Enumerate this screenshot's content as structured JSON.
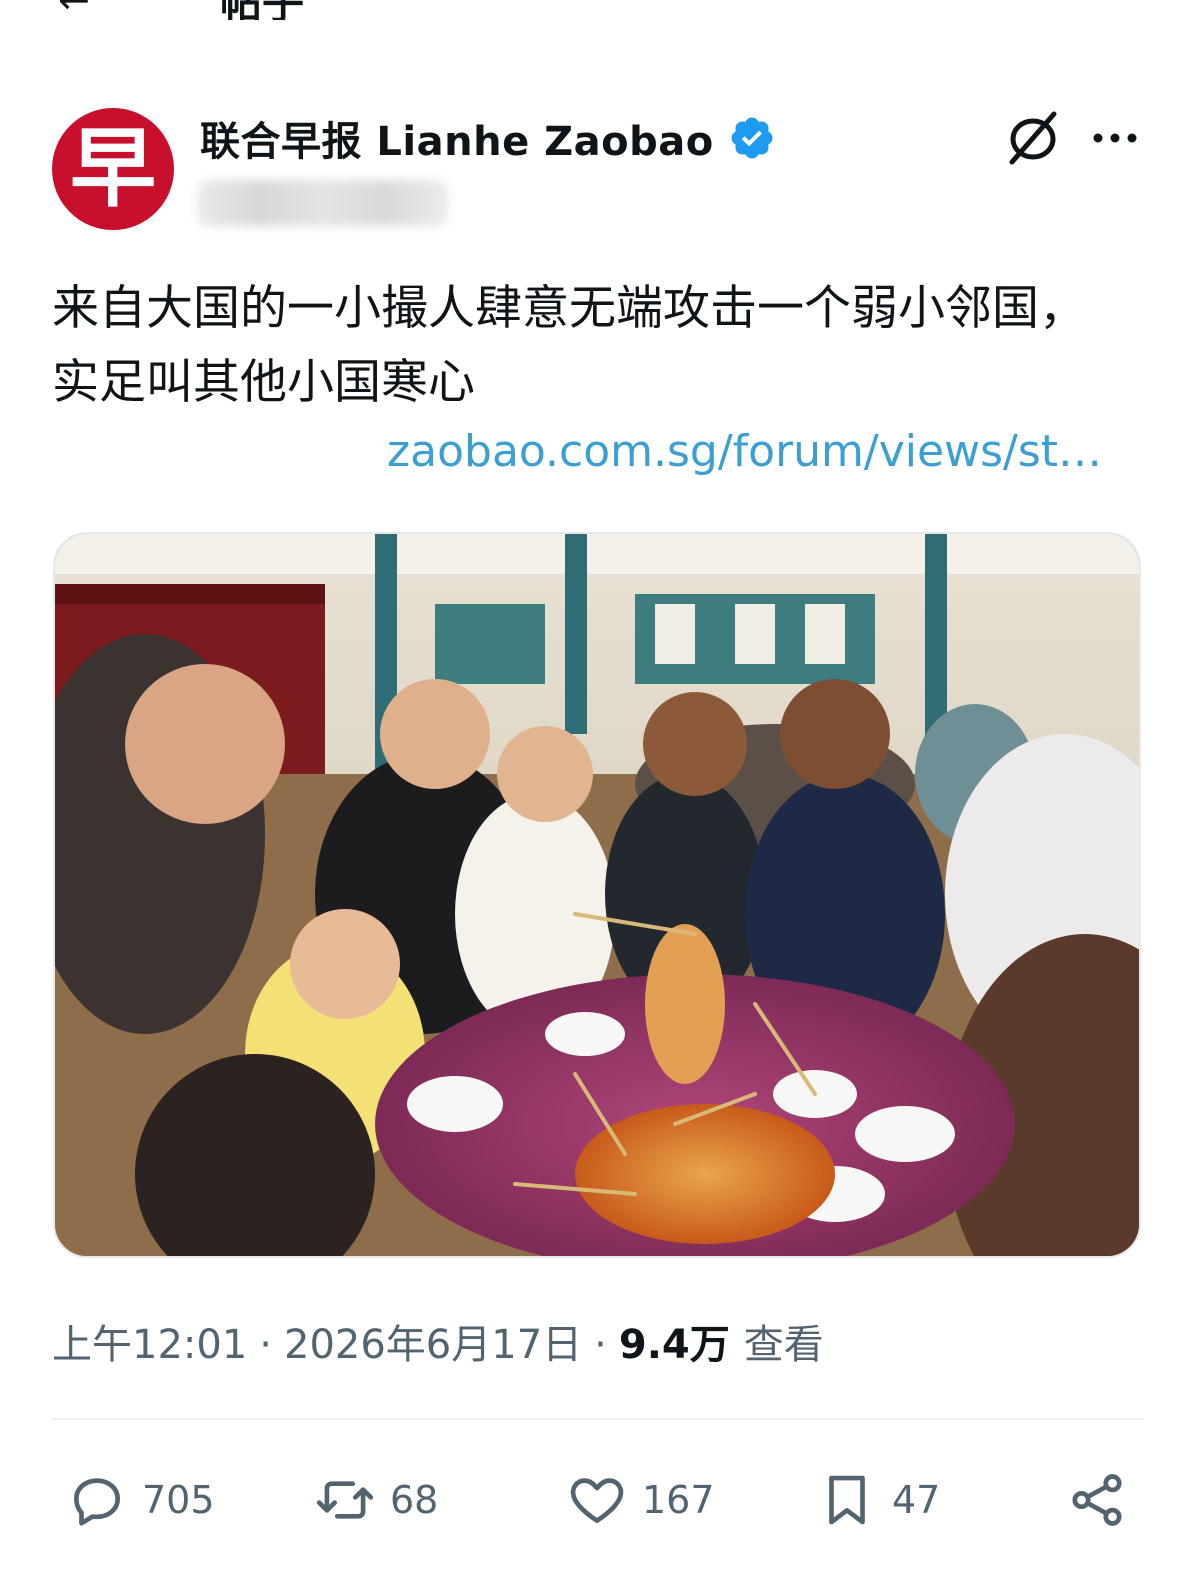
{
  "nav": {
    "back_icon": "arrow-left-icon",
    "title": "帖子"
  },
  "account": {
    "name": "联合早报 Lianhe Zaobao",
    "avatar_glyph": "早",
    "verified_icon": "verified-badge-icon",
    "avatar_color": "#c8102e",
    "verified_color": "#1d9bf0"
  },
  "header_icons": {
    "grok": "grok-icon",
    "more": "more-icon"
  },
  "tweet": {
    "text": "来自大国的一小撮人肆意无端攻击一个弱小邻国，实足叫其他小国寒心",
    "link": "zaobao.com.sg/forum/views/st…",
    "link_color": "#3b9fd4"
  },
  "meta": {
    "time": "上午12:01",
    "separator": "·",
    "date": "2026年6月17日",
    "views_count": "9.4万",
    "views_label": "查看"
  },
  "actions": {
    "reply": {
      "icon": "reply-icon",
      "count": "705"
    },
    "repost": {
      "icon": "repost-icon",
      "count": "68"
    },
    "like": {
      "icon": "heart-icon",
      "count": "167"
    },
    "bookmark": {
      "icon": "bookmark-icon",
      "count": "47"
    },
    "share": {
      "icon": "share-icon"
    }
  }
}
